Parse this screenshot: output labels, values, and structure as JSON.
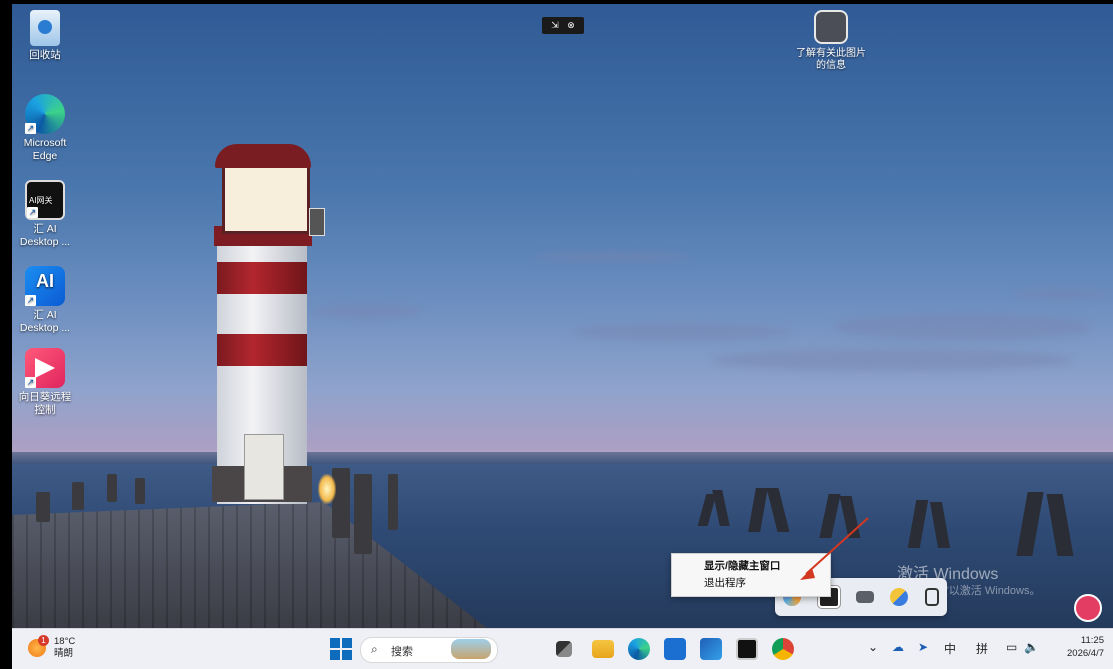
{
  "desktop": {
    "icons": [
      {
        "label": "回收站",
        "icon": "recycle-bin-icon"
      },
      {
        "label": "Microsoft Edge",
        "icon": "edge-icon"
      },
      {
        "label": "汇 AI Desktop ...",
        "icon": "ai-gateway-icon",
        "badge": "AI网关"
      },
      {
        "label": "汇 AI Desktop ...",
        "icon": "ai-icon",
        "badge": "AI"
      },
      {
        "label": "向日葵远程控制",
        "icon": "sunlogin-icon"
      }
    ],
    "info_icon_label": "了解有关此图片的信息"
  },
  "watermark": {
    "title": "激活 Windows",
    "subtitle": "转到\"设置\"以激活 Windows。"
  },
  "context_menu": {
    "items": [
      "显示/隐藏主窗口",
      "退出程序"
    ]
  },
  "taskbar": {
    "weather": {
      "badge": "1",
      "temp": "18°C",
      "condition": "晴朗"
    },
    "search_placeholder": "搜索",
    "tray": {
      "ime_lang": "中",
      "ime_mode": "拼"
    },
    "clock": {
      "time": "11:25",
      "date": "2026/4/7"
    }
  },
  "colors": {
    "accent": "#0f6cbd",
    "taskbar_bg": "#eef0f5",
    "arrow": "#d2381f"
  }
}
